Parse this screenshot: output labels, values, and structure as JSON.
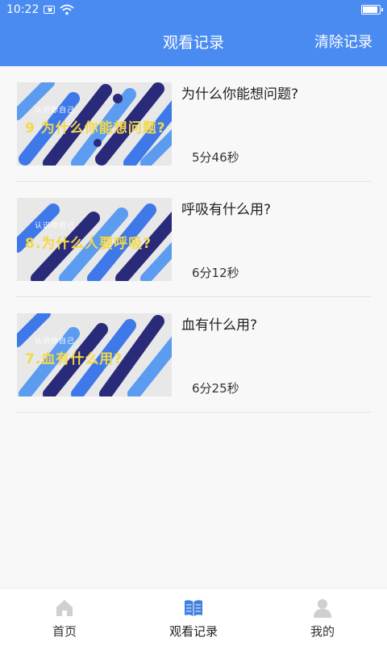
{
  "status": {
    "time": "10:22"
  },
  "header": {
    "title": "观看记录",
    "clear_label": "清除记录"
  },
  "colors": {
    "accent": "#4a8bf1",
    "navy": "#2a2a7a",
    "stripe_blue": "#3f78e8",
    "stripe_light": "#5b9cf0",
    "thumb_text": "#f3d84a"
  },
  "items": [
    {
      "title": "为什么你能想问题?",
      "duration": "5分46秒",
      "thumb_small": "认识你自己",
      "thumb_big": "9 为什么你能想问题?"
    },
    {
      "title": "呼吸有什么用?",
      "duration": "6分12秒",
      "thumb_small": "认识你自己",
      "thumb_big": "8.为什么人要呼吸?"
    },
    {
      "title": "血有什么用?",
      "duration": "6分25秒",
      "thumb_small": "认识你自己",
      "thumb_big": "7.血有什么用?"
    }
  ],
  "nav": [
    {
      "label": "首页",
      "icon": "home-icon"
    },
    {
      "label": "观看记录",
      "icon": "book-icon"
    },
    {
      "label": "我的",
      "icon": "person-icon"
    }
  ]
}
